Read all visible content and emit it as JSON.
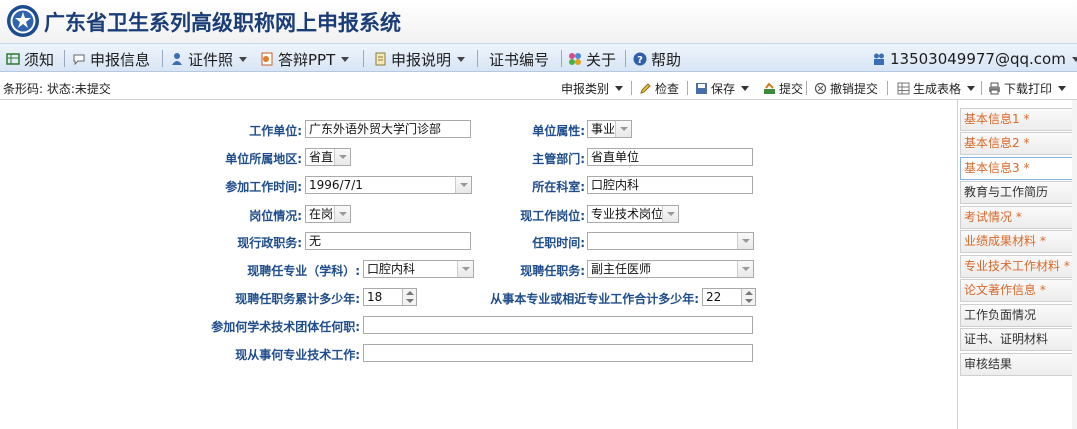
{
  "app": {
    "title": "广东省卫生系列高级职称网上申报系统"
  },
  "menu": {
    "items": [
      {
        "label": "须知",
        "icon": "grid-icon",
        "has_caret": false
      },
      {
        "label": "申报信息",
        "icon": "chat-icon",
        "has_caret": false
      },
      {
        "label": "证件照",
        "icon": "person-icon",
        "has_caret": true
      },
      {
        "label": "答辩PPT",
        "icon": "ppt-icon",
        "has_caret": true
      },
      {
        "label": "申报说明",
        "icon": "document-icon",
        "has_caret": true
      },
      {
        "label": "证书编号",
        "icon": "",
        "has_caret": false
      },
      {
        "label": "关于",
        "icon": "flower-icon",
        "has_caret": false
      },
      {
        "label": "帮助",
        "icon": "help-icon",
        "has_caret": false
      }
    ],
    "user": {
      "label": "13503049977@qq.com",
      "icon": "users-icon"
    }
  },
  "toolbar": {
    "status": "条形码:  状态:未提交",
    "buttons": [
      {
        "label": "申报类别",
        "icon": "",
        "caret": true
      },
      {
        "label": "检查",
        "icon": "pen-icon",
        "caret": false
      },
      {
        "label": "保存",
        "icon": "save-icon",
        "caret": true
      },
      {
        "label": "提交",
        "icon": "submit-icon",
        "caret": false
      },
      {
        "label": "撤销提交",
        "icon": "undo-icon",
        "caret": false
      },
      {
        "label": "生成表格",
        "icon": "table-icon",
        "caret": true
      },
      {
        "label": "下载打印",
        "icon": "print-icon",
        "caret": true
      }
    ]
  },
  "form": {
    "work_unit": {
      "label": "工作单位:",
      "value": "广东外语外贸大学门诊部"
    },
    "unit_attr": {
      "label": "单位属性:",
      "value": "事业"
    },
    "unit_region": {
      "label": "单位所属地区:",
      "value": "省直"
    },
    "supervisor": {
      "label": "主管部门:",
      "value": "省直单位"
    },
    "start_work": {
      "label": "参加工作时间:",
      "value": "1996/7/1"
    },
    "department": {
      "label": "所在科室:",
      "value": "口腔内科"
    },
    "post_status": {
      "label": "岗位情况:",
      "value": "在岗"
    },
    "current_post": {
      "label": "现工作岗位:",
      "value": "专业技术岗位"
    },
    "admin_post": {
      "label": "现行政职务:",
      "value": "无"
    },
    "tenure_time": {
      "label": "任职时间:",
      "value": ""
    },
    "major": {
      "label": "现聘任专业（学科）:",
      "value": "口腔内科"
    },
    "position": {
      "label": "现聘任职务:",
      "value": "副主任医师"
    },
    "years_position": {
      "label": "现聘任职务累计多少年:",
      "value": "18"
    },
    "years_major": {
      "label": "从事本专业或相近专业工作合计多少年:",
      "value": "22"
    },
    "academic_groups": {
      "label": "参加何学术技术团体任何职:",
      "value": ""
    },
    "specialty_work": {
      "label": "现从事何专业技术工作:",
      "value": ""
    }
  },
  "sidenav": {
    "items": [
      {
        "label": "基本信息1 *",
        "color": "orange",
        "active": false
      },
      {
        "label": "基本信息2 *",
        "color": "orange",
        "active": false
      },
      {
        "label": "基本信息3 *",
        "color": "orange",
        "active": true
      },
      {
        "label": "教育与工作简历",
        "color": "gray",
        "active": false
      },
      {
        "label": "考试情况 *",
        "color": "orange",
        "active": false
      },
      {
        "label": "业绩成果材料 *",
        "color": "orange",
        "active": false
      },
      {
        "label": "专业技术工作材料 *",
        "color": "orange",
        "active": false
      },
      {
        "label": "论文著作信息 *",
        "color": "orange",
        "active": false
      },
      {
        "label": "工作负面情况",
        "color": "gray",
        "active": false
      },
      {
        "label": "证书、证明材料",
        "color": "gray",
        "active": false
      },
      {
        "label": "审核结果",
        "color": "gray",
        "active": false
      }
    ]
  },
  "colors": {
    "title": "#1a3d78",
    "label": "#1f4d8c",
    "nav_required": "#d9692a",
    "menubar": "#dbe7f6"
  }
}
